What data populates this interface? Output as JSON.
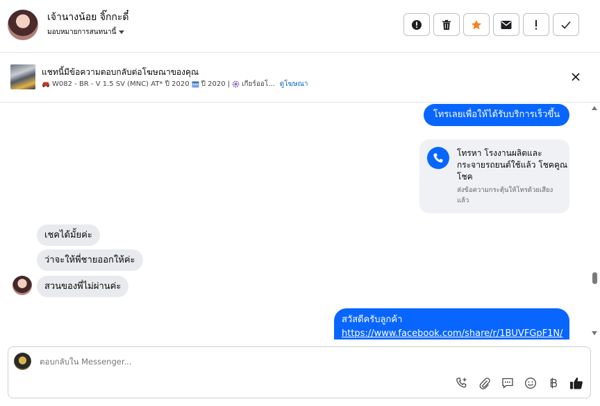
{
  "header": {
    "user_name": "เจ้านางน้อย จิ๊กกะดี๋",
    "assign_label": "มอบหมายการสนทนานี้",
    "actions": [
      {
        "icon": "alert-circle-icon"
      },
      {
        "icon": "trash-icon"
      },
      {
        "icon": "star-icon",
        "color": "#f5821f"
      },
      {
        "icon": "envelope-icon"
      },
      {
        "icon": "exclamation-icon"
      },
      {
        "icon": "checkmark-icon"
      }
    ]
  },
  "ad_banner": {
    "title": "แชทนี้มีข้อความตอบกลับต่อโฆษณาของคุณ",
    "car_code": "W082 - BR - V 1.5 SV (MNC) AT* ปี 2020",
    "year": "ปี 2020 |",
    "gear": "เกียร์ออโ...",
    "link": "ดูโฆษณา"
  },
  "messages": {
    "outgoing_1": "โทรเลยเพื่อให้ได้รับบริการเร็วขึ้น",
    "call_card": {
      "title": "โทรหา โรงงานผลิตและกระจายรถยนต์ใช้แล้ว โชคคูณโชค",
      "subtitle": "ส่งข้อความกระตุ้นให้โทรด้วยเสียงแล้ว"
    },
    "incoming": [
      "เชคได้มั้ยค่ะ",
      "ว่าจะให้พี่ชายออกให้ค่ะ",
      "สวนของพี่ไม่ผ่านค่ะ"
    ],
    "outgoing_2": {
      "greeting": "สวัสดีครับลูกค้า",
      "link": "https://www.facebook.com/share/r/1BUVFGpF1N/"
    }
  },
  "composer": {
    "placeholder": "ตอบกลับใน Messenger...",
    "tools": [
      "call-add-icon",
      "paperclip-icon",
      "chat-icon",
      "emoji-icon",
      "baht-icon",
      "thumbs-up-icon"
    ]
  },
  "colors": {
    "accent": "#0866ff",
    "star": "#f5821f",
    "link": "#0a62c8"
  }
}
